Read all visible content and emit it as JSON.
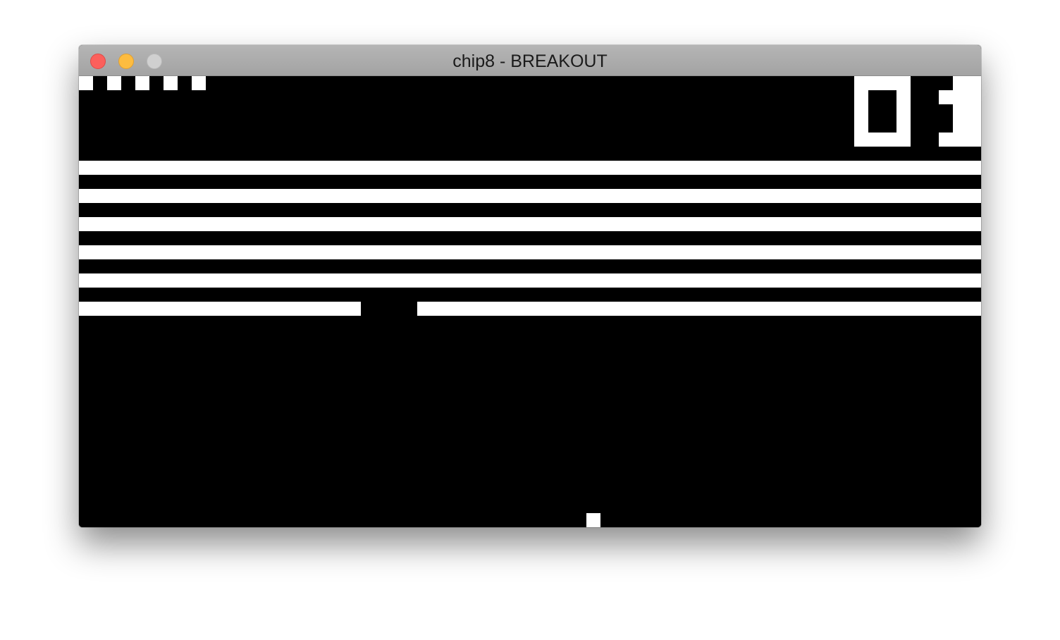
{
  "window": {
    "title": "chip8 - BREAKOUT"
  },
  "colors": {
    "pixel_on": "#ffffff",
    "pixel_off": "#000000",
    "close": "#fc605c",
    "minimize": "#fdbc40",
    "zoom": "#d0d0d0"
  },
  "game": {
    "lives_remaining": 5,
    "score_text": "01",
    "brick_rows": 6,
    "last_row_missing_bricks": 1
  }
}
